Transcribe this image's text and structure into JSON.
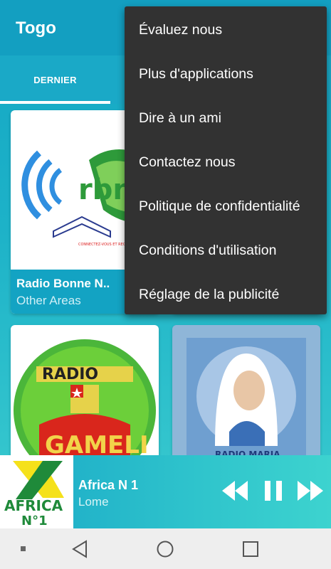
{
  "header": {
    "title": "Togo"
  },
  "tabs": [
    {
      "label": "DERNIER"
    }
  ],
  "stations": [
    {
      "name": "Radio Bonne N..",
      "area": "Other Areas",
      "logo_text": "CONNECTEZ-VOUS ET RECEVEZ LA VIE !",
      "logo_letters": "rbn"
    },
    {
      "logo_text": "RADIO",
      "logo_sub": "GAMELI"
    },
    {
      "logo_text": "RADIO MARIA"
    }
  ],
  "menu": {
    "items": [
      "Évaluez nous",
      "Plus d'applications",
      "Dire à un ami",
      "Contactez nous",
      "Politique de confidentialité",
      "Conditions d'utilisation",
      "Réglage de la publicité"
    ]
  },
  "player": {
    "title": "Africa N 1",
    "subtitle": "Lome",
    "logo_text": "AFRICA",
    "logo_sub": "N°1"
  },
  "colors": {
    "accent": "#139fc1",
    "menu_bg": "#323232",
    "gameli_green": "#4bb63a",
    "gameli_red": "#d9261c"
  },
  "icons": {
    "rewind": "rewind-icon",
    "pause": "pause-icon",
    "forward": "fast-forward-icon",
    "nav_back": "back-icon",
    "nav_home": "home-icon",
    "nav_recent": "recent-apps-icon"
  }
}
